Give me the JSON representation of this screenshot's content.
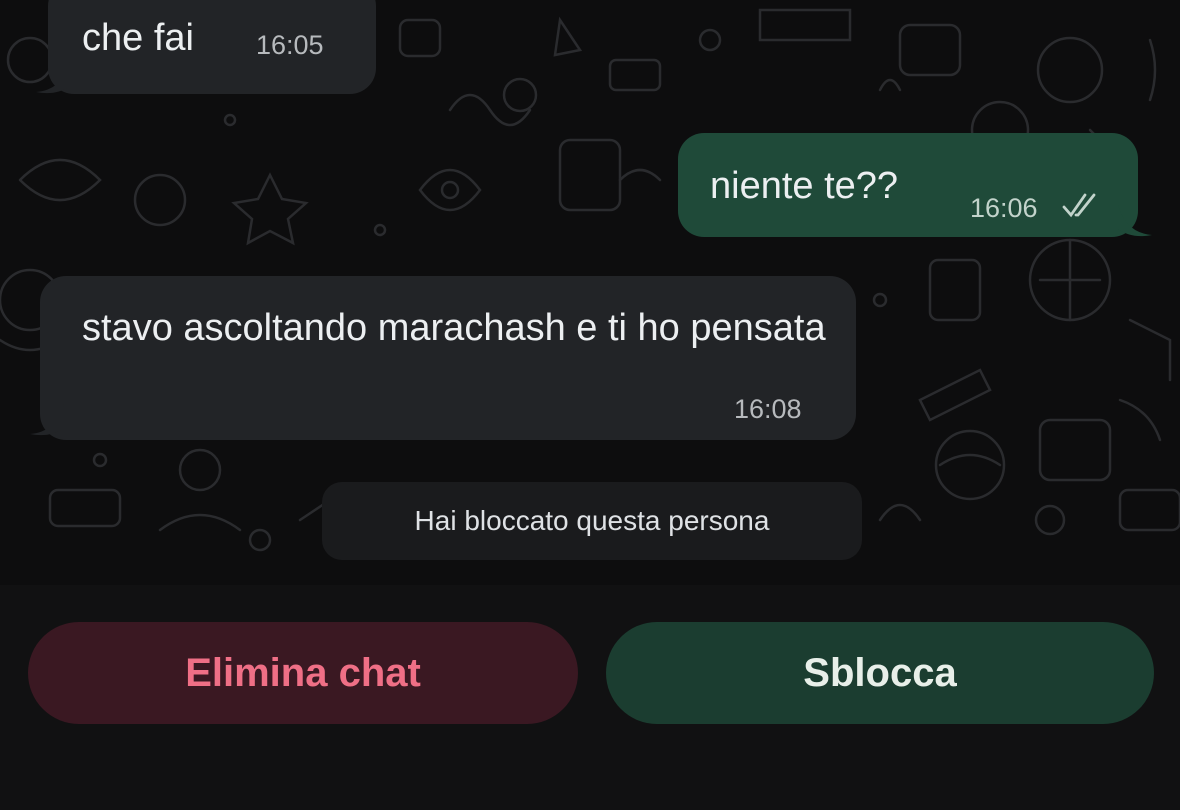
{
  "messages": [
    {
      "direction": "incoming",
      "text": "che fai",
      "time": "16:05"
    },
    {
      "direction": "outgoing",
      "text": "niente te??",
      "time": "16:06",
      "status_icon": "double-check-icon"
    },
    {
      "direction": "incoming",
      "text": "stavo ascoltando marachash e ti ho pensata",
      "time": "16:08"
    }
  ],
  "system_note": "Hai bloccato questa persona",
  "actions": {
    "delete_label": "Elimina chat",
    "unblock_label": "Sblocca"
  },
  "colors": {
    "incoming_bubble": "#222427",
    "outgoing_bubble": "#1f4a39",
    "delete_text": "#ef6f86",
    "delete_bg": "#3a1822",
    "unblock_bg": "#1b3d30"
  }
}
